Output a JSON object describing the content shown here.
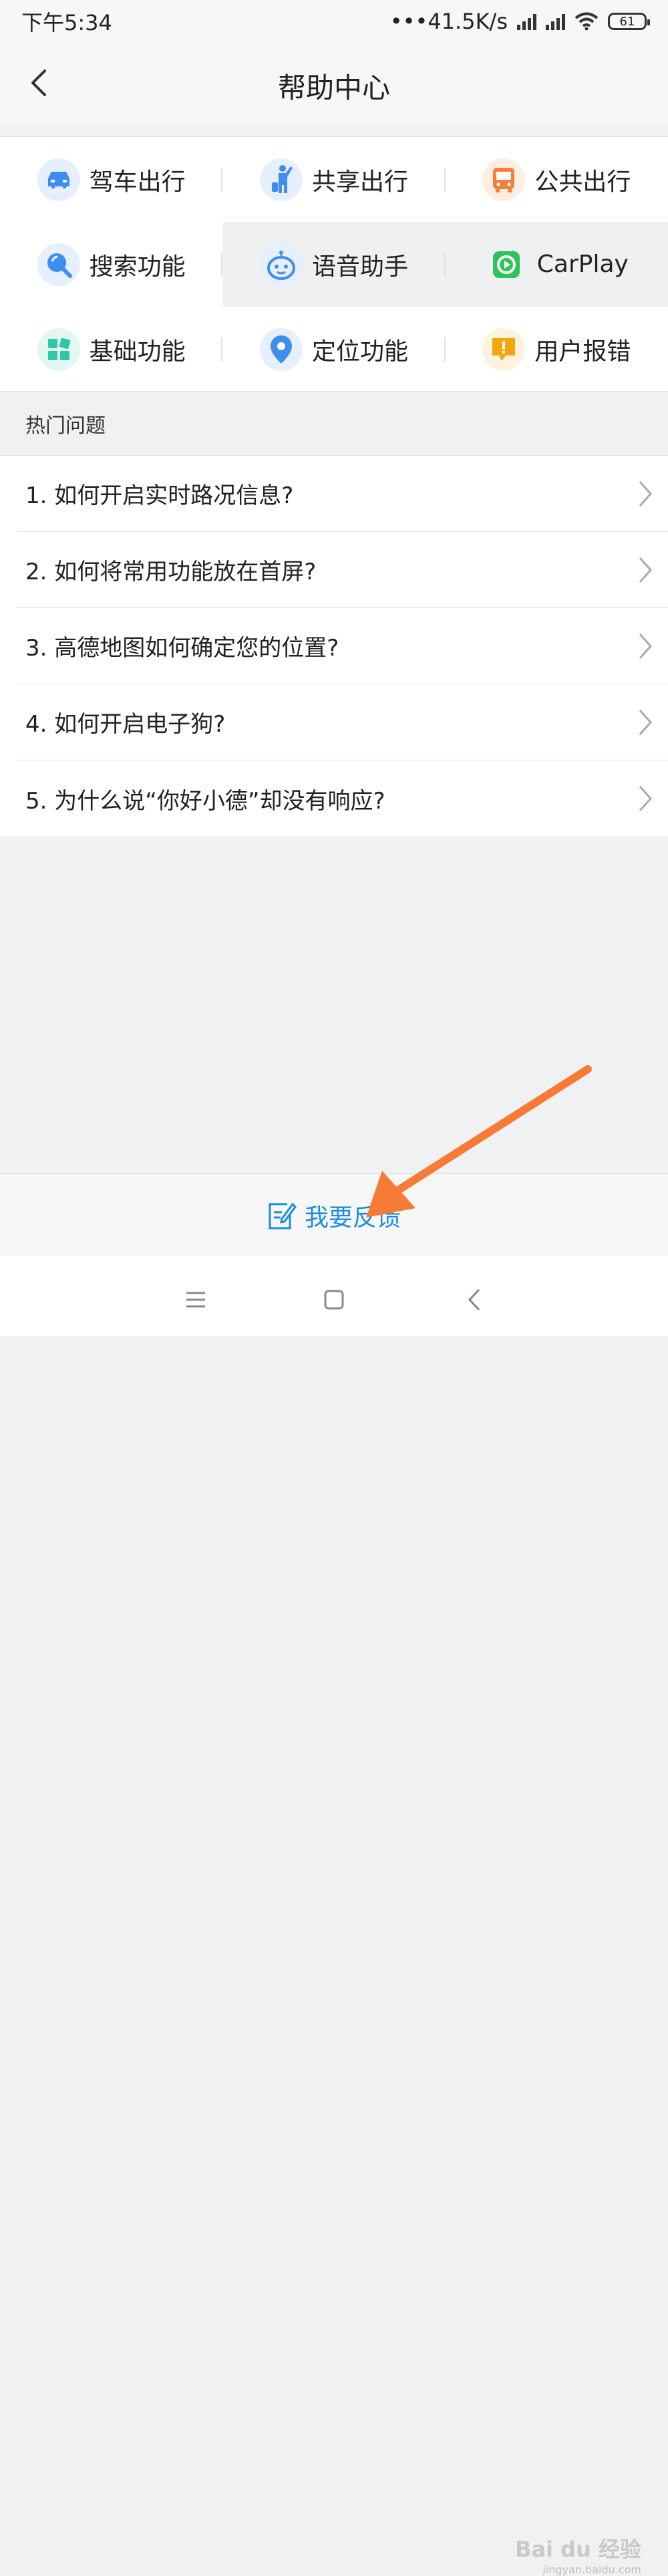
{
  "status_bar": {
    "time": "下午5:34",
    "network_speed": "•••41.5K/s",
    "battery": "61"
  },
  "header": {
    "title": "帮助中心",
    "back_icon": "chevron-left-icon"
  },
  "categories": [
    {
      "label": "驾车出行",
      "icon": "car-icon",
      "color": "#3d8ef0",
      "bg": "#e6f0fd"
    },
    {
      "label": "共享出行",
      "icon": "person-luggage-icon",
      "color": "#3d8ef0",
      "bg": "#e6f0fd"
    },
    {
      "label": "公共出行",
      "icon": "bus-icon",
      "color": "#f47f3b",
      "bg": "#fdeee4"
    },
    {
      "label": "搜索功能",
      "icon": "search-icon",
      "color": "#3d8ef0",
      "bg": "#e6f0fd"
    },
    {
      "label": "语音助手",
      "icon": "robot-icon",
      "color": "#3d8ef0",
      "bg": "#e6f0fd"
    },
    {
      "label": "CarPlay",
      "icon": "carplay-icon",
      "color": "#2ec45a",
      "bg": "transparent"
    },
    {
      "label": "基础功能",
      "icon": "blocks-icon",
      "color": "#2fc7a6",
      "bg": "#e3f7f2"
    },
    {
      "label": "定位功能",
      "icon": "location-pin-icon",
      "color": "#3d8ef0",
      "bg": "#e6f0fd"
    },
    {
      "label": "用户报错",
      "icon": "alert-bubble-icon",
      "color": "#f5a60c",
      "bg": "#fef3dc"
    }
  ],
  "hot_questions": {
    "title": "热门问题",
    "items": [
      "1. 如何开启实时路况信息?",
      "2. 如何将常用功能放在首屏?",
      "3. 高德地图如何确定您的位置?",
      "4. 如何开启电子狗?",
      "5. 为什么说“你好小德”却没有响应?"
    ]
  },
  "feedback": {
    "label": "我要反馈",
    "icon": "edit-note-icon"
  },
  "watermark": {
    "text": "Bai du 经验",
    "sub": "jingyan.baidu.com"
  },
  "colors": {
    "accent": "#1a8ee0",
    "arrow": "#f77a35"
  }
}
